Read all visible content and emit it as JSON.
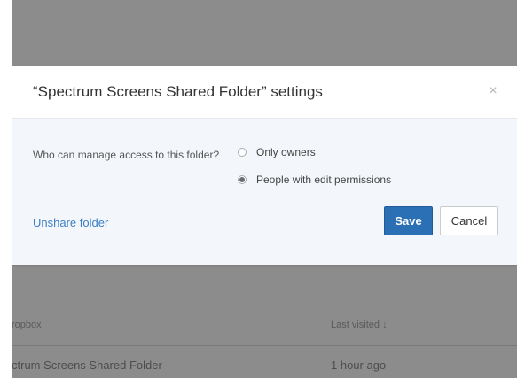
{
  "modal": {
    "title": "“Spectrum Screens Shared Folder” settings",
    "close_icon": "×",
    "question": "Who can manage access to this folder?",
    "options": [
      {
        "label": "Only owners",
        "selected": false
      },
      {
        "label": "People with edit permissions",
        "selected": true
      }
    ],
    "unshare_label": "Unshare folder",
    "save_label": "Save",
    "cancel_label": "Cancel"
  },
  "background": {
    "column_name": "ropbox",
    "column_visited": "Last visited ↓",
    "rows": [
      {
        "name": "ctrum Screens Shared Folder",
        "time": "1 hour ago"
      }
    ]
  },
  "colors": {
    "accent": "#2b6fb5",
    "link": "#3d7fc4",
    "overlay": "#8c8c8c",
    "modal_body": "#f3f7fb"
  }
}
